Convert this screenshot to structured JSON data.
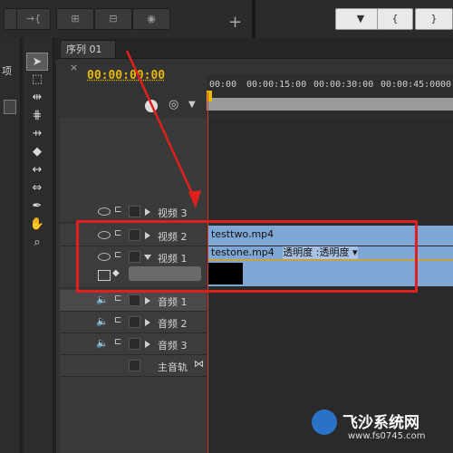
{
  "topbar": {
    "buttons_left": [
      "→{",
      "⊞",
      "⊟",
      "◉"
    ],
    "plus_label": "+",
    "buttons_right": [
      "▼",
      "{",
      "}"
    ]
  },
  "left_panel": {
    "label": "项"
  },
  "sequence": {
    "tab_label": "序列 01",
    "tab_close": "×",
    "timecode": "00:00:00:00",
    "ruler_ticks": [
      "00:00",
      "00:00:15:00",
      "00:00:30:00",
      "00:00:45:00",
      "00:"
    ]
  },
  "video_tracks": [
    {
      "label": "视频 3"
    },
    {
      "label": "视频 2",
      "clip": "testtwo.mp4"
    },
    {
      "label": "视频 1",
      "clip": "testone.mp4",
      "clip_fx": "透明度 :透明度 ▾"
    }
  ],
  "audio_tracks": [
    {
      "label": "音频 1"
    },
    {
      "label": "音频 2"
    },
    {
      "label": "音频 3"
    },
    {
      "label": "主音轨"
    }
  ],
  "watermark": {
    "title": "飞沙系统网",
    "url": "www.fs0745.com"
  },
  "colors": {
    "highlight": "#e0201c",
    "clip": "#7fa7d6",
    "timecode": "#e8b800"
  }
}
